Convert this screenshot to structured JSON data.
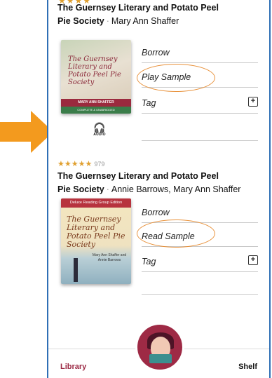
{
  "book1": {
    "title": "The Guernsey Literary and Potato Peel",
    "title_line2": "Pie Society",
    "author": "Mary Ann Shaffer",
    "format_label": "AUDIO",
    "cover_text": "The Guernsey Literary and Potato Peel Pie Society",
    "cover_author": "MARY ANN SHAFFER",
    "cover_note": "COMPLETE & UNABRIDGED",
    "actions": {
      "borrow": "Borrow",
      "sample": "Play Sample",
      "tag": "Tag"
    }
  },
  "book2": {
    "stars": "★★★★★",
    "rating_count": "979",
    "title": "The Guernsey Literary and Potato Peel",
    "title_line2": "Pie Society",
    "author": "Annie Barrows, Mary Ann Shaffer",
    "cover_banner": "Deluxe Reading Group Edition",
    "cover_text": "The Guernsey Literary and Potato Peel Pie Society",
    "cover_author": "Mary Ann Shaffer and Annie Barrows",
    "actions": {
      "borrow": "Borrow",
      "sample": "Read Sample",
      "tag": "Tag"
    }
  },
  "nav": {
    "library": "Library",
    "shelf": "Shelf"
  },
  "colors": {
    "frame": "#2f6fb5",
    "highlight": "#e8913a",
    "arrow": "#f39a1e",
    "accent": "#9c2a45",
    "stars": "#e0a030"
  }
}
